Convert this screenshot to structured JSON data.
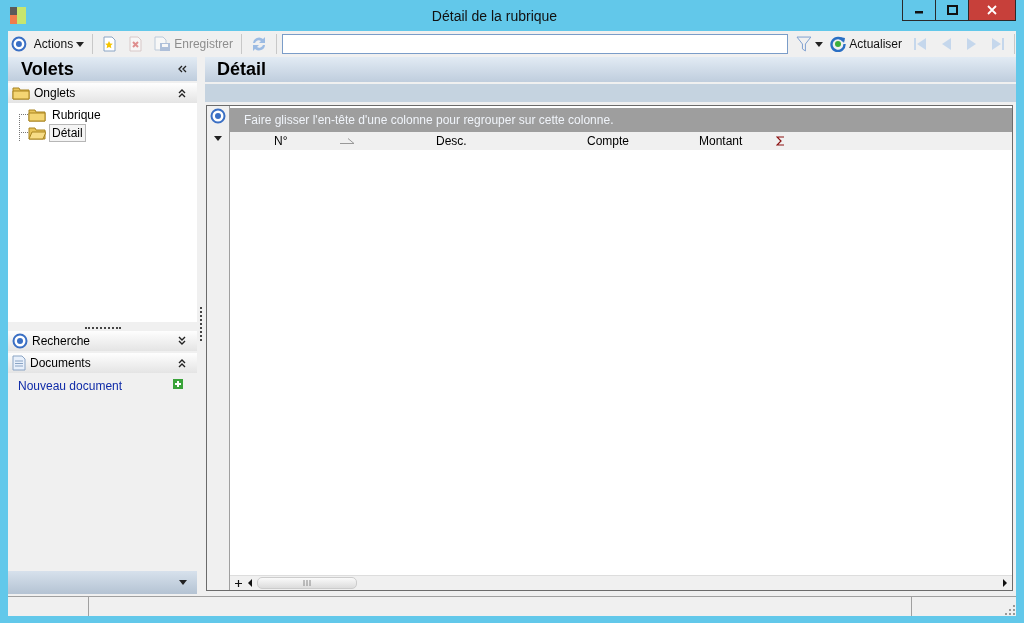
{
  "window": {
    "title": "Détail de la rubrique"
  },
  "toolbar": {
    "actions_label": "Actions",
    "new": {
      "disabled": false
    },
    "delete": {
      "disabled": true
    },
    "save": {
      "label": "Enregistrer",
      "disabled": true
    },
    "sync": {
      "disabled": true
    },
    "refresh_label": "Actualiser",
    "navigation": [
      {
        "kind": "first",
        "disabled": true
      },
      {
        "kind": "previous",
        "disabled": true
      },
      {
        "kind": "next",
        "disabled": true
      },
      {
        "kind": "last",
        "disabled": true
      }
    ]
  },
  "sidebar": {
    "title": "Volets",
    "sections": [
      {
        "kind": "tree",
        "title": "Onglets",
        "expanded": true,
        "items": [
          {
            "label": "Rubrique",
            "selected": false
          },
          {
            "label": "Détail",
            "selected": true
          }
        ]
      },
      {
        "kind": "search",
        "title": "Recherche",
        "expanded": false
      },
      {
        "kind": "documents",
        "title": "Documents",
        "expanded": true,
        "links": [
          "Nouveau document"
        ]
      }
    ]
  },
  "detail": {
    "title": "Détail",
    "grid": {
      "group_hint": "Faire glisser l'en-tête d'une colonne pour regrouper sur cette colonne.",
      "columns": [
        {
          "label": "N°",
          "sorted": true,
          "summary": false
        },
        {
          "label": "Desc.",
          "sorted": false,
          "summary": false
        },
        {
          "label": "Compte",
          "sorted": false,
          "summary": false
        },
        {
          "label": "Montant",
          "sorted": false,
          "summary": true
        }
      ]
    }
  }
}
